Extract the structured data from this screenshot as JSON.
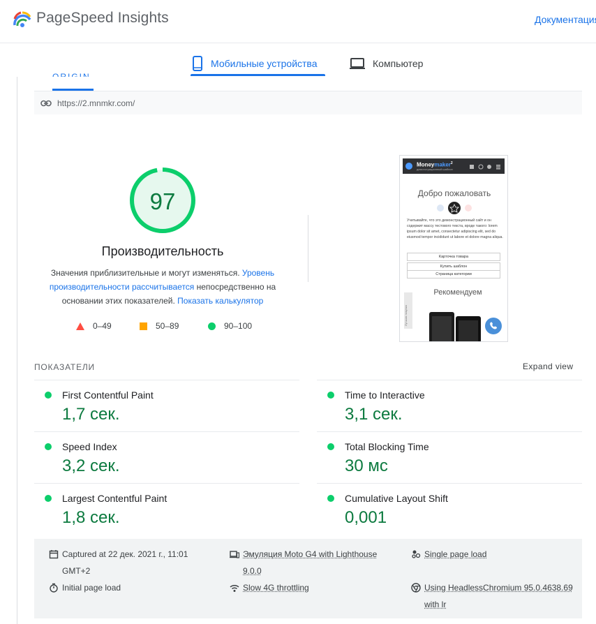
{
  "header": {
    "brand": "PageSpeed Insights",
    "doc_link": "Документация"
  },
  "tabs": [
    {
      "label": "Мобильные устройства",
      "active": true,
      "icon": "smartphone-icon"
    },
    {
      "label": "Компьютер",
      "active": false,
      "icon": "laptop-icon"
    }
  ],
  "subtab": {
    "label": "ORIGIN"
  },
  "url_bar": {
    "url": "https://2.mnmkr.com/",
    "icon": "link-icon"
  },
  "score": {
    "value": "97",
    "fraction": 0.97,
    "title": "Производительность",
    "desc_part1": "Значения приблизительные и могут изменяться. ",
    "desc_link1": "Уровень производительности рассчитывается",
    "desc_part2": " непосредственно на основании этих показателей. ",
    "desc_link2": "Показать калькулятор",
    "color": "#0cce6b"
  },
  "legend": [
    {
      "range": "0–49",
      "shape": "triangle",
      "color": "#ff4e42"
    },
    {
      "range": "50–89",
      "shape": "square",
      "color": "#ffa400"
    },
    {
      "range": "90–100",
      "shape": "circle",
      "color": "#0cce6b"
    }
  ],
  "thumbnail": {
    "logo_a": "Money",
    "logo_b": "maker",
    "logo_sup": "2",
    "logo_sub": "демонстрационный шаблон",
    "welcome": "Добро пожаловать",
    "body_text": "Учитывайте, что это демонстрационный сайт и он содержит массу тестового текста, вроде такого: lorem ipsum dolor sit amet, consectetur adipiscing elit, sed do eiusmod tempor incididunt ut labore et dolore magna aliqua.",
    "buttons": [
      "Карточка товара",
      "Купить шаблон",
      "Страница категории"
    ],
    "recommend": "Рекомендуем",
    "side_label": "Лучшая покупка"
  },
  "metrics": {
    "heading": "ПОКАЗАТЕЛИ",
    "expand": "Expand view",
    "items": [
      {
        "name": "First Contentful Paint",
        "value": "1,7 сек."
      },
      {
        "name": "Time to Interactive",
        "value": "3,1 сек."
      },
      {
        "name": "Speed Index",
        "value": "3,2 сек."
      },
      {
        "name": "Total Blocking Time",
        "value": "30 мс"
      },
      {
        "name": "Largest Contentful Paint",
        "value": "1,8 сек."
      },
      {
        "name": "Cumulative Layout Shift",
        "value": "0,001"
      }
    ]
  },
  "info": [
    {
      "icon": "calendar-icon",
      "text": "Captured at 22 дек. 2021 г., 11:01 GMT+2"
    },
    {
      "icon": "device-icon",
      "text": "Эмуляция Moto G4 with Lighthouse 9.0.0"
    },
    {
      "icon": "pages-icon",
      "text": "Single page load"
    },
    {
      "icon": "timer-icon",
      "text": "Initial page load"
    },
    {
      "icon": "wifi-icon",
      "text": "Slow 4G throttling"
    },
    {
      "icon": "chrome-icon",
      "text": "Using HeadlessChromium 95.0.4638.69 with lr"
    }
  ]
}
